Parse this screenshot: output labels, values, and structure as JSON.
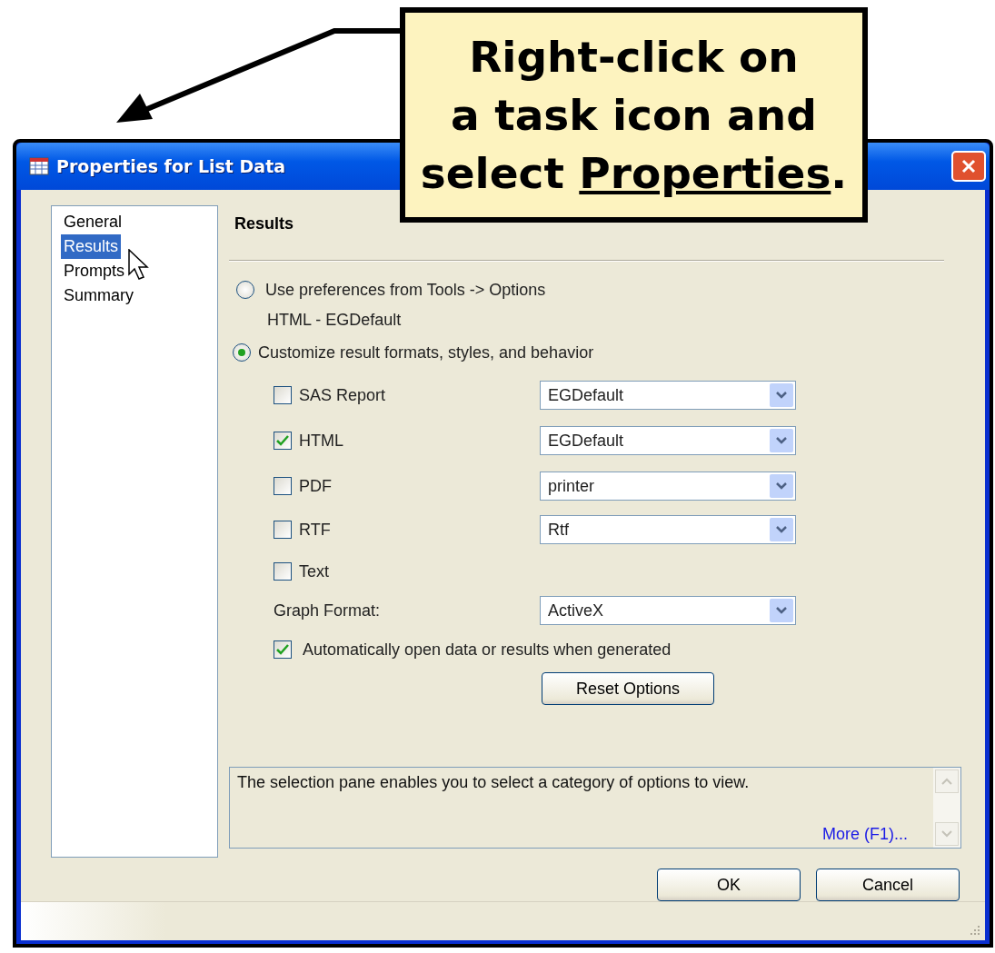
{
  "window": {
    "title": "Properties for List Data"
  },
  "callout": {
    "text": "Right-click on a task icon and select",
    "emphasis": "Properties",
    "end": "."
  },
  "sidebar": {
    "items": [
      {
        "label": "General",
        "selected": false
      },
      {
        "label": "Results",
        "selected": true
      },
      {
        "label": "Prompts",
        "selected": false
      },
      {
        "label": "Summary",
        "selected": false
      }
    ]
  },
  "panel": {
    "heading": "Results",
    "options": [
      {
        "label": "Use preferences from Tools -> Options",
        "selected": false,
        "detail": "HTML - EGDefault"
      },
      {
        "label": "Customize result formats, styles, and behavior",
        "selected": true
      }
    ],
    "formats": [
      {
        "label": "SAS Report",
        "checked": false,
        "dropdown": "EGDefault"
      },
      {
        "label": "HTML",
        "checked": true,
        "dropdown": "EGDefault"
      },
      {
        "label": "PDF",
        "checked": false,
        "dropdown": "printer"
      },
      {
        "label": "RTF",
        "checked": false,
        "dropdown": "Rtf"
      },
      {
        "label": "Text",
        "checked": false
      }
    ],
    "graph_format": {
      "label": "Graph Format:",
      "value": "ActiveX"
    },
    "auto_open": {
      "label": "Automatically open data or results when generated",
      "checked": true
    },
    "reset_button": "Reset Options"
  },
  "help": {
    "text": "The selection pane enables you to select a category of options to view.",
    "link": "More (F1)..."
  },
  "buttons": [
    "OK",
    "Cancel"
  ]
}
